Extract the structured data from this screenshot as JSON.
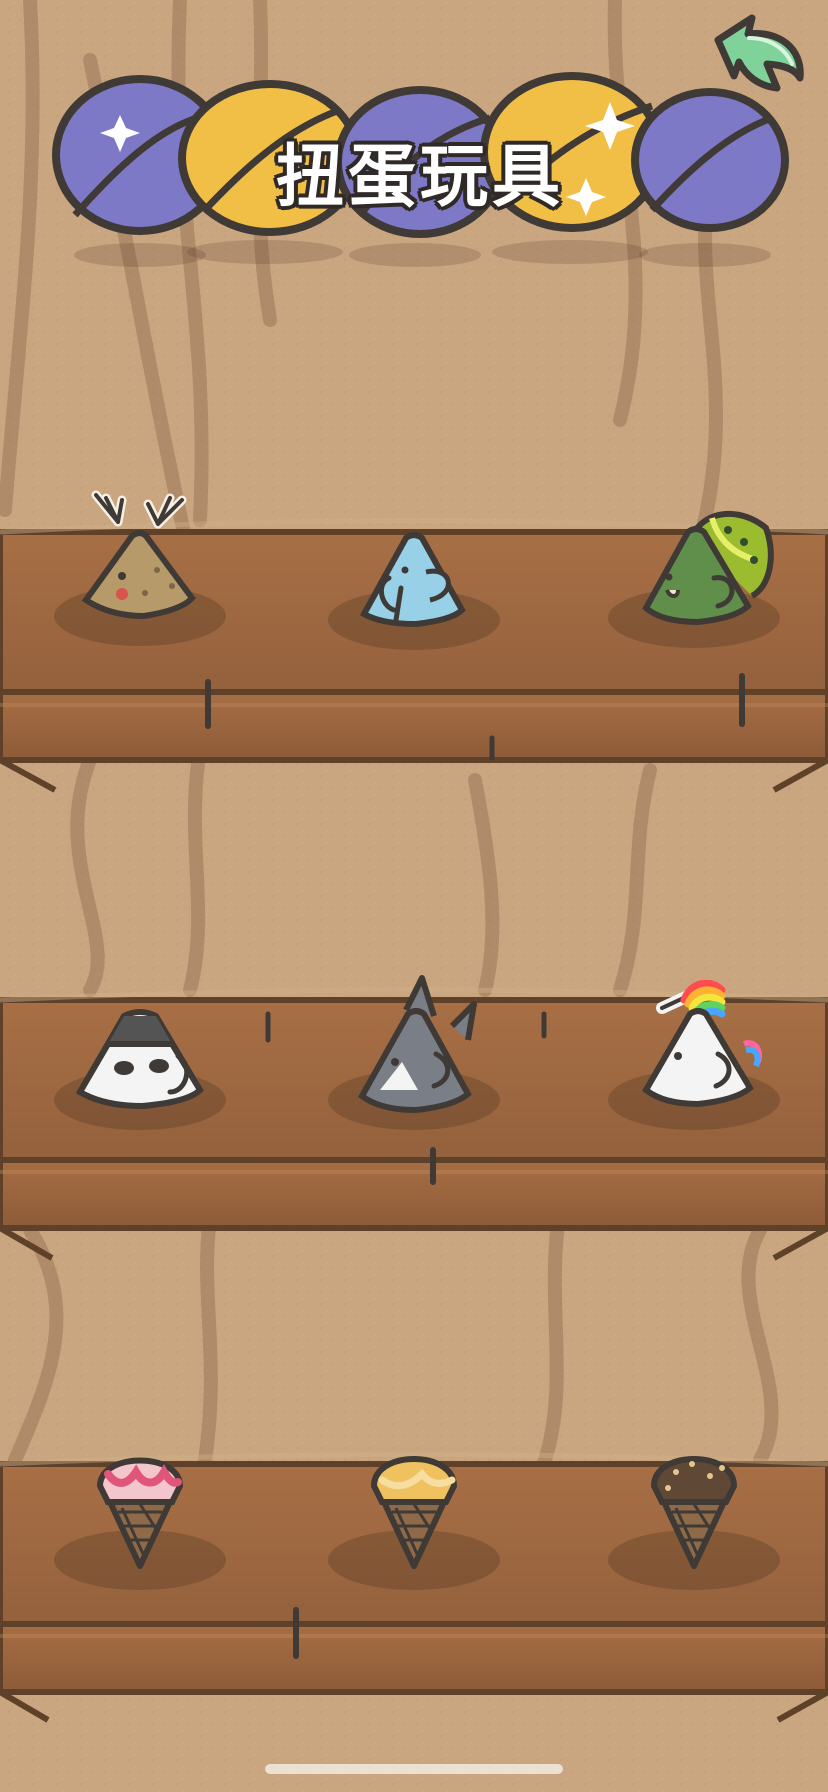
{
  "screen": {
    "title": "扭蛋玩具"
  },
  "colors": {
    "wall": "#c9a680",
    "shelf": "#9f6a42",
    "shelf_edge": "#6d4a2f",
    "outline": "#3f3a36",
    "back_arrow": "#7fd29a",
    "capsule_blue": "#7e79c7",
    "capsule_yellow": "#f2bf46"
  },
  "header": {
    "back_icon": "back-arrow-icon",
    "capsules": [
      "blue",
      "yellow",
      "blue",
      "yellow",
      "blue"
    ]
  },
  "shelves": [
    {
      "row": "top",
      "toys": [
        {
          "name": "deer",
          "color": "#b79a69"
        },
        {
          "name": "elephant",
          "color": "#98d0e7"
        },
        {
          "name": "peacock",
          "color": "#5f8f4a"
        }
      ]
    },
    {
      "row": "middle",
      "toys": [
        {
          "name": "panda",
          "color": "#f4f4f4"
        },
        {
          "name": "shark",
          "color": "#7a7f87"
        },
        {
          "name": "unicorn",
          "color": "#f4f4f4"
        }
      ]
    },
    {
      "row": "bottom",
      "toys": [
        {
          "name": "strawberry-ice-cream",
          "color": "#f3c5cc"
        },
        {
          "name": "mango-ice-cream",
          "color": "#efc25f"
        },
        {
          "name": "chocolate-ice-cream",
          "color": "#5f4936"
        }
      ]
    }
  ]
}
